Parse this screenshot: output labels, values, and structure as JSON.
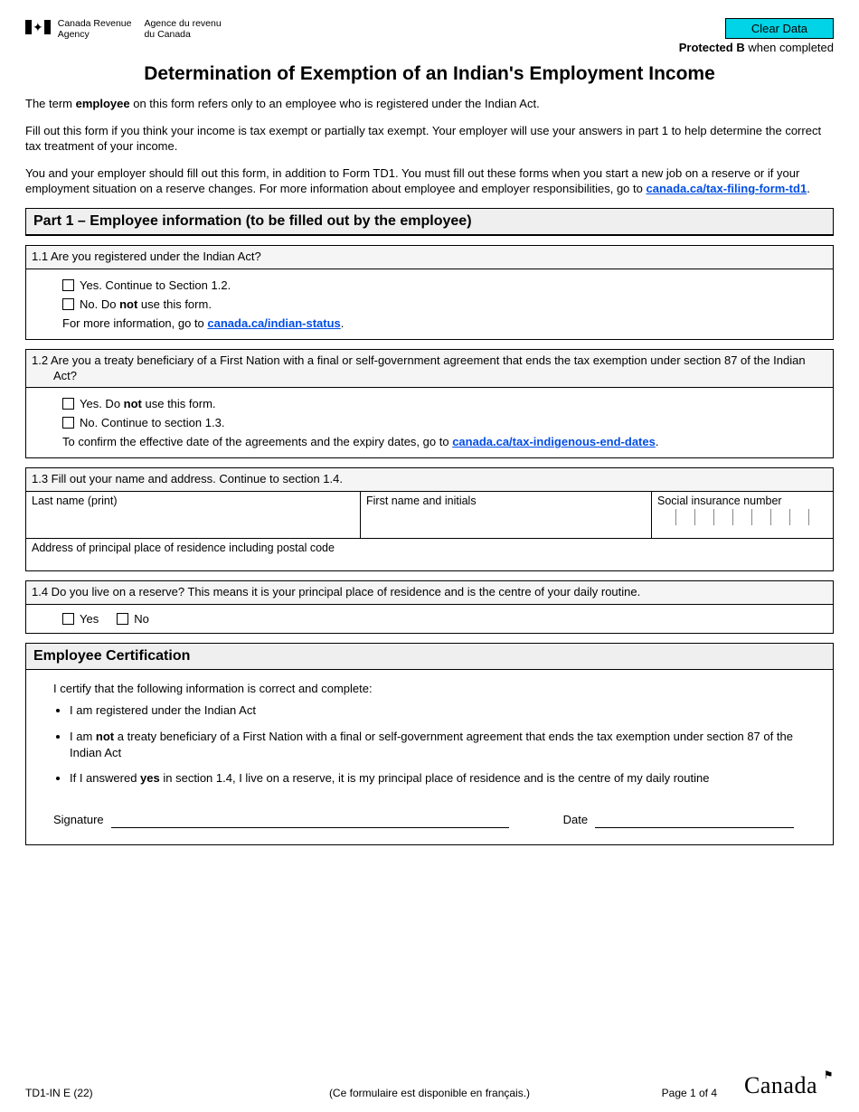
{
  "header": {
    "agency_en_1": "Canada Revenue",
    "agency_en_2": "Agency",
    "agency_fr_1": "Agence du revenu",
    "agency_fr_2": "du Canada",
    "clear_button": "Clear Data",
    "protected_b": "Protected B",
    "protected_suffix": " when completed"
  },
  "title": "Determination of Exemption of an Indian's Employment Income",
  "intro": {
    "p1_a": "The term ",
    "p1_b": "employee",
    "p1_c": " on this form refers only to an employee who is registered under the Indian Act.",
    "p2": "Fill out this form if you think your income is tax exempt or partially tax exempt. Your employer will use your answers in part 1 to help determine the correct tax treatment of your income.",
    "p3_a": "You and your employer should fill out this form, in addition to Form TD1. You must fill out these forms when you start a new job on a reserve or if your employment situation on a reserve changes. For more information about employee and employer responsibilities, go to ",
    "p3_link": "canada.ca/tax-filing-form-td1",
    "p3_b": "."
  },
  "part1": {
    "heading": "Part 1 – Employee information (to be filled out by the employee)",
    "q11": {
      "question": "1.1 Are you registered under the Indian Act?",
      "yes": "Yes. Continue to Section 1.2.",
      "no_a": "No. Do ",
      "no_b": "not",
      "no_c": " use this form.",
      "info_a": "For more information, go to ",
      "info_link": "canada.ca/indian-status",
      "info_b": "."
    },
    "q12": {
      "question": "1.2 Are you a treaty beneficiary of a First Nation with a final or self-government agreement that ends the tax exemption under section 87 of the Indian Act?",
      "yes_a": "Yes. Do ",
      "yes_b": "not",
      "yes_c": " use this form.",
      "no": "No. Continue to section 1.3.",
      "info_a": "To confirm the effective date of the agreements and the expiry dates, go to ",
      "info_link": "canada.ca/tax-indigenous-end-dates",
      "info_b": "."
    },
    "q13": {
      "head": "1.3 Fill out your name and address. Continue to section 1.4.",
      "last": "Last name (print)",
      "first": "First name and initials",
      "sin": "Social insurance number",
      "addr": "Address of principal place of residence including postal code"
    },
    "q14": {
      "question": "1.4 Do you live on a reserve? This means it is your principal place of residence and is the centre of your daily routine.",
      "yes": "Yes",
      "no": "No"
    }
  },
  "cert": {
    "heading": "Employee Certification",
    "lead": "I certify that the following information is correct and complete:",
    "b1": "I am registered under the Indian Act",
    "b2_a": "I am ",
    "b2_b": "not",
    "b2_c": " a treaty beneficiary of a First Nation with a final or self-government agreement that ends the tax exemption under section 87 of the Indian Act",
    "b3_a": "If I answered ",
    "b3_b": "yes",
    "b3_c": " in section 1.4, I live on a reserve, it is my principal place of residence and is the centre of my daily routine",
    "sig_label": "Signature",
    "date_label": "Date"
  },
  "footer": {
    "form_code": "TD1-IN E (22)",
    "center": "(Ce formulaire est disponible en français.)",
    "page": "Page 1 of 4",
    "wordmark": "Canada"
  }
}
